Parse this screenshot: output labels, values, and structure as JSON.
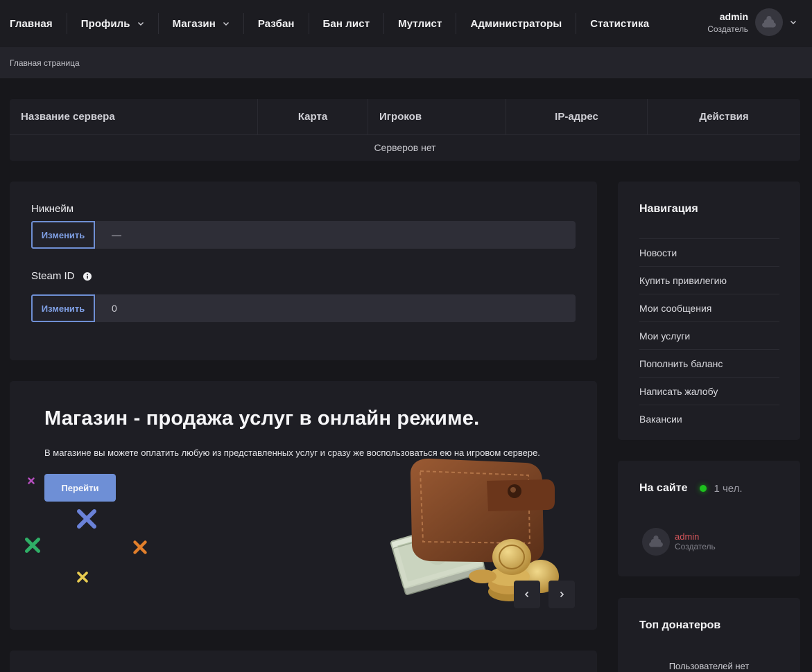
{
  "nav": {
    "items": [
      {
        "label": "Главная",
        "dropdown": false
      },
      {
        "label": "Профиль",
        "dropdown": true
      },
      {
        "label": "Магазин",
        "dropdown": true
      },
      {
        "label": "Разбан",
        "dropdown": false
      },
      {
        "label": "Бан лист",
        "dropdown": false
      },
      {
        "label": "Мутлист",
        "dropdown": false
      },
      {
        "label": "Администраторы",
        "dropdown": false
      },
      {
        "label": "Статистика",
        "dropdown": false
      }
    ],
    "user": {
      "name": "admin",
      "role": "Создатель"
    }
  },
  "breadcrumb": "Главная страница",
  "servers": {
    "headers": [
      "Название сервера",
      "Карта",
      "Игроков",
      "IP-адрес",
      "Действия"
    ],
    "empty_text": "Серверов нет"
  },
  "profile": {
    "nickname_label": "Никнейм",
    "nickname_value": "—",
    "steam_label": "Steam ID",
    "steam_value": "0",
    "change_label": "Изменить"
  },
  "shop": {
    "title": "Магазин - продажа услуг в онлайн режиме.",
    "description": "В магазине вы можете оплатить любую из представленных услуг и сразу же воспользоваться ею на игровом сервере.",
    "button": "Перейти"
  },
  "sidebar": {
    "nav_title": "Навигация",
    "nav_items": [
      "Новости",
      "Купить привилегию",
      "Мои сообщения",
      "Мои услуги",
      "Пополнить баланс",
      "Написать жалобу",
      "Вакансии"
    ],
    "online_title": "На сайте",
    "online_count": "1 чел.",
    "online_user": {
      "name": "admin",
      "role": "Создатель"
    },
    "donors_title": "Топ донатеров",
    "donors_empty": "Пользователей нет"
  },
  "colors": {
    "accent": "#6e8fd6",
    "online": "#1dc21d",
    "username_red": "#d2555a"
  }
}
